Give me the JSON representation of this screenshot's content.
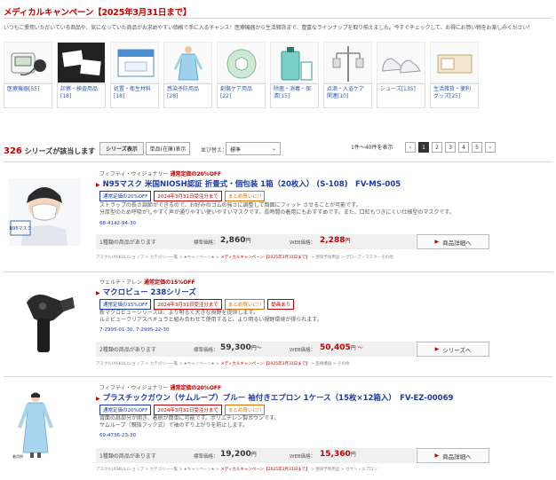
{
  "page": {
    "title": "メディカルキャンペーン【2025年3月31日まで】",
    "intro": "いつもご愛用いただいている商品や、気になっていた商品がお求めやすい価格で手に入るチャンス！医療機器から生活雑貨まで、豊富なラインナップを取り揃えました。今すぐチェックして、お得にお買い物をお楽しみください！"
  },
  "categories": [
    {
      "label": "医療機器[55]",
      "icon": "blood-pressure-monitor"
    },
    {
      "label": "診察・検査用品[18]",
      "icon": "gauze"
    },
    {
      "label": "処置・衛生材料[18]",
      "icon": "bandage-pack"
    },
    {
      "label": "感染予防用品[28]",
      "icon": "isolation-gown"
    },
    {
      "label": "創傷ケア用品[22]",
      "icon": "tape-roll"
    },
    {
      "label": "除菌・消毒・保清[15]",
      "icon": "disinfectant-bottle"
    },
    {
      "label": "点滴・入浴ケア関連[10]",
      "icon": "iv-stand"
    },
    {
      "label": "シューズ[135]",
      "icon": "shoes"
    },
    {
      "label": "生活雑貨・便利グッズ[25]",
      "icon": "goods"
    }
  ],
  "toolbar": {
    "count": "326",
    "count_suffix": "シリーズが該当します",
    "view_series": "シリーズ表示",
    "view_single": "単品(在庫)表示",
    "sort_label": "並び替え：",
    "sort_value": "標準",
    "range": "1件〜40件を表示",
    "pages": [
      "‹",
      "1",
      "2",
      "3",
      "4",
      "5",
      "›"
    ]
  },
  "products": [
    {
      "maker": "フィフティ・ウィジョナリー",
      "discount": "通常定価の20%OFF",
      "name": "N95マスク 米国NIOSH認証 折畳式・個包装 1箱（20枚入） (S-108)　FV-MS-005",
      "tags": [
        {
          "text": "通常定価の20%OFF",
          "tone": "blue"
        },
        {
          "text": "2024年3月31日受注分まで",
          "tone": "red"
        },
        {
          "text": "まとめ買いに!!",
          "tone": "orange"
        }
      ],
      "desc": "ストラップの長さ調節ができるので、お好みのゴムの強さに調整して顔面にフィット させることが可能です。\n分厚型のため呼吸がしやすく声が通りやすい使いやすいマスクです。長時間の着用にもおすすめです。また、口紅もつきにくい仕様型のマスクです。",
      "codes": "68-4142-94-30",
      "avail": "1種類の商品があります",
      "std_label": "標準価格：",
      "std_price": "2,860",
      "std_suffix": "円",
      "web_label": "WEB価格：",
      "web_price": "2,288",
      "web_suffix": "円",
      "button": "商品詳細へ",
      "crumbs": [
        "アスクル(ASKUL)ショップ",
        "カテゴリー一覧",
        "★キャンペーン★",
        "メディカルキャンペーン【2025年3月31日まで】",
        "感染予防用品",
        "グローブ・マスク・その他"
      ]
    },
    {
      "maker": "ウェルチ・アレン",
      "discount": "通常定価の15%OFF",
      "name": "マクロビュー 238シリーズ",
      "tags": [
        {
          "text": "通常定価の15%OFF",
          "tone": "blue"
        },
        {
          "text": "2024年3月31日受注分まで",
          "tone": "red"
        },
        {
          "text": "まとめ買いに!!",
          "tone": "orange"
        },
        {
          "text": "動画あり",
          "tone": "red"
        }
      ],
      "desc": "新マクロビューシリーズは、より明るく大きな視野を提供します。\nルミビュークリアスペキュラと組み合わせて使用すると、より明るい視野環境が得られます。",
      "codes": "7-2995-01-30, 7-2995-22-30",
      "avail": "2種類の商品があります",
      "std_label": "標準価格：",
      "std_price": "59,300",
      "std_suffix": "円〜",
      "web_label": "WEB価格：",
      "web_price": "50,405",
      "web_suffix": "円 〜",
      "button": "シリーズへ",
      "crumbs": [
        "アスクル(ASKUL)ショップ",
        "カテゴリー一覧",
        "★キャンペーン★",
        "メディカルキャンペーン【2025年3月31日まで】",
        "医療機器",
        "その他"
      ]
    },
    {
      "maker": "フィフティ・ウィジョナリー",
      "discount": "通常定価の20%OFF",
      "name": "プラスチックガウン（サムループ）ブルー 袖付きエプロン 1ケース（15枚×12箱入）　FV-EZ-00069",
      "tags": [
        {
          "text": "通常定価の20%OFF",
          "tone": "blue"
        },
        {
          "text": "2024年3月31日受注分まで",
          "tone": "red"
        },
        {
          "text": "まとめ買いに!!",
          "tone": "orange"
        }
      ],
      "desc": "背面の肩部分が開き、着脱が簡単に可能です。ポリエチレン製ガウンです。\nサムループ（親指フック式）で袖のずり上がりを防止します。",
      "codes": "69-4736-23-30",
      "avail": "1種類の商品があります",
      "std_label": "標準価格：",
      "std_price": "19,200",
      "std_suffix": "円",
      "web_label": "WEB価格：",
      "web_price": "15,360",
      "web_suffix": "円",
      "button": "商品詳細へ",
      "crumbs": [
        "アスクル(ASKUL)ショップ",
        "カテゴリー一覧",
        "★キャンペーン★",
        "メディカルキャンペーン【2025年3月31日まで】",
        "感染予防用品",
        "ガウン・エプロン"
      ]
    }
  ],
  "image_text": {
    "mask_box": "N95マスク",
    "gown_caption": "着用例"
  }
}
